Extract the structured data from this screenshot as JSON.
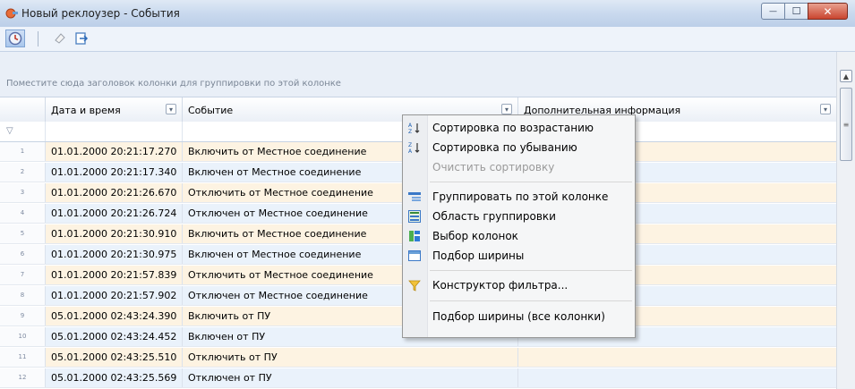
{
  "window": {
    "title": "Новый реклоузер - События",
    "controls": {
      "minimize": "—",
      "maximize": "☐",
      "close": "✕"
    }
  },
  "toolbar": {
    "buttons": [
      {
        "name": "refresh",
        "icon": "clock-refresh-icon",
        "active": true
      },
      {
        "name": "clear",
        "icon": "eraser-icon",
        "active": false
      },
      {
        "name": "export",
        "icon": "export-arrow-icon",
        "active": false
      }
    ]
  },
  "grouping": {
    "hint": "Поместите сюда заголовок колонки для группировки по этой колонке"
  },
  "grid": {
    "columns": [
      {
        "key": "num",
        "label": ""
      },
      {
        "key": "datetime",
        "label": "Дата и время"
      },
      {
        "key": "event",
        "label": "Событие"
      },
      {
        "key": "info",
        "label": "Дополнительная информация"
      }
    ],
    "filter_icon": "funnel-icon",
    "rows": [
      {
        "n": "1",
        "datetime": "01.01.2000 20:21:17.270",
        "event": "Включить от Местное соединение",
        "info": ""
      },
      {
        "n": "2",
        "datetime": "01.01.2000 20:21:17.340",
        "event": "Включен от Местное соединение",
        "info": ""
      },
      {
        "n": "3",
        "datetime": "01.01.2000 20:21:26.670",
        "event": "Отключить от Местное соединение",
        "info": ""
      },
      {
        "n": "4",
        "datetime": "01.01.2000 20:21:26.724",
        "event": "Отключен от Местное соединение",
        "info": ""
      },
      {
        "n": "5",
        "datetime": "01.01.2000 20:21:30.910",
        "event": "Включить от Местное соединение",
        "info": ""
      },
      {
        "n": "6",
        "datetime": "01.01.2000 20:21:30.975",
        "event": "Включен от Местное соединение",
        "info": ""
      },
      {
        "n": "7",
        "datetime": "01.01.2000 20:21:57.839",
        "event": "Отключить от Местное соединение",
        "info": ""
      },
      {
        "n": "8",
        "datetime": "01.01.2000 20:21:57.902",
        "event": "Отключен от Местное соединение",
        "info": ""
      },
      {
        "n": "9",
        "datetime": "05.01.2000 02:43:24.390",
        "event": "Включить от ПУ",
        "info": ""
      },
      {
        "n": "10",
        "datetime": "05.01.2000 02:43:24.452",
        "event": "Включен от ПУ",
        "info": ""
      },
      {
        "n": "11",
        "datetime": "05.01.2000 02:43:25.510",
        "event": "Отключить от ПУ",
        "info": ""
      },
      {
        "n": "12",
        "datetime": "05.01.2000 02:43:25.569",
        "event": "Отключен от ПУ",
        "info": ""
      }
    ]
  },
  "context_menu": {
    "items": [
      {
        "label": "Сортировка по возрастанию",
        "icon": "sort-ascending-icon",
        "enabled": true
      },
      {
        "label": "Сортировка по убыванию",
        "icon": "sort-descending-icon",
        "enabled": true
      },
      {
        "label": "Очистить сортировку",
        "icon": "",
        "enabled": false
      },
      {
        "label": "Группировать по этой колонке",
        "icon": "group-by-column-icon",
        "enabled": true
      },
      {
        "label": "Область группировки",
        "icon": "group-panel-icon",
        "enabled": true
      },
      {
        "label": "Выбор колонок",
        "icon": "column-chooser-icon",
        "enabled": true
      },
      {
        "label": "Подбор ширины",
        "icon": "best-fit-icon",
        "enabled": true
      },
      {
        "label": "Конструктор фильтра...",
        "icon": "filter-builder-icon",
        "enabled": true
      },
      {
        "label": "Подбор ширины (все колонки)",
        "icon": "",
        "enabled": true
      }
    ]
  },
  "colors": {
    "row_odd": "#fdf3e2",
    "row_even": "#eaf2fb",
    "accent": "#7fa4d3"
  }
}
